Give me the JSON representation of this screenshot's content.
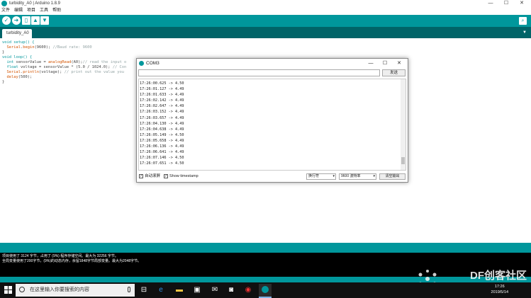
{
  "ide": {
    "title": "turbidity_A0 | Arduino 1.8.9",
    "menu": [
      "文件",
      "编辑",
      "项目",
      "工具",
      "帮助"
    ],
    "tab": "turbidity_A0",
    "code_lines": [
      [
        {
          "t": "void setup() {",
          "c": "kw"
        }
      ],
      [
        {
          "t": "  ",
          "c": ""
        },
        {
          "t": "Serial",
          "c": "fn"
        },
        {
          "t": ".",
          "c": ""
        },
        {
          "t": "begin",
          "c": "fn"
        },
        {
          "t": "(9600); ",
          "c": ""
        },
        {
          "t": "//Baud rate: 9600",
          "c": "cm"
        }
      ],
      [
        {
          "t": "}",
          "c": ""
        }
      ],
      [
        {
          "t": "void loop() {",
          "c": "kw"
        }
      ],
      [
        {
          "t": "  ",
          "c": ""
        },
        {
          "t": "int",
          "c": "kw"
        },
        {
          "t": " sensorValue = ",
          "c": ""
        },
        {
          "t": "analogRead",
          "c": "fn"
        },
        {
          "t": "(A0);",
          "c": ""
        },
        {
          "t": "// read the input o",
          "c": "cm"
        }
      ],
      [
        {
          "t": "  ",
          "c": ""
        },
        {
          "t": "float",
          "c": "kw"
        },
        {
          "t": " voltage = sensorValue * (5.0 / 1024.0); ",
          "c": ""
        },
        {
          "t": "// Con",
          "c": "cm"
        }
      ],
      [
        {
          "t": "  ",
          "c": ""
        },
        {
          "t": "Serial",
          "c": "fn"
        },
        {
          "t": ".",
          "c": ""
        },
        {
          "t": "println",
          "c": "fn"
        },
        {
          "t": "(voltage); ",
          "c": ""
        },
        {
          "t": "// print out the value you",
          "c": "cm"
        }
      ],
      [
        {
          "t": "  ",
          "c": ""
        },
        {
          "t": "delay",
          "c": "fn"
        },
        {
          "t": "(500);",
          "c": ""
        }
      ],
      [
        {
          "t": "}",
          "c": ""
        }
      ]
    ],
    "console_lines": [
      "项目使用了 3124 字节，占用了 (9%) 程序存储空间。最大为 32256 字节。",
      "全局变量使用了200字节，(9%)的动态内存，余留1848字节局部变量。最大为2048字节。"
    ]
  },
  "serial_monitor": {
    "title": "COM3",
    "send_label": "发送",
    "input_value": "",
    "lines": [
      "17:26:00.625 -> 4.50",
      "17:26:01.127 -> 4.49",
      "17:26:01.633 -> 4.49",
      "17:26:02.142 -> 4.49",
      "17:26:02.647 -> 4.49",
      "17:26:03.152 -> 4.49",
      "17:26:03.657 -> 4.49",
      "17:26:04.130 -> 4.49",
      "17:26:04.638 -> 4.49",
      "17:26:05.149 -> 4.50",
      "17:26:05.658 -> 4.49",
      "17:26:06.136 -> 4.49",
      "17:26:06.641 -> 4.49",
      "17:26:07.146 -> 4.50",
      "17:26:07.651 -> 4.50"
    ],
    "autoscroll_label": "自动滚屏",
    "timestamp_label": "Show timestamp",
    "autoscroll_checked": true,
    "timestamp_checked": true,
    "line_ending": "换行符",
    "baud": "9600 波特率",
    "clear_label": "清空输出"
  },
  "taskbar": {
    "search_placeholder": "在这里输入你要搜索的内容",
    "time": "17:26",
    "date": "2019/5/14"
  },
  "watermark": "DF创客社区"
}
